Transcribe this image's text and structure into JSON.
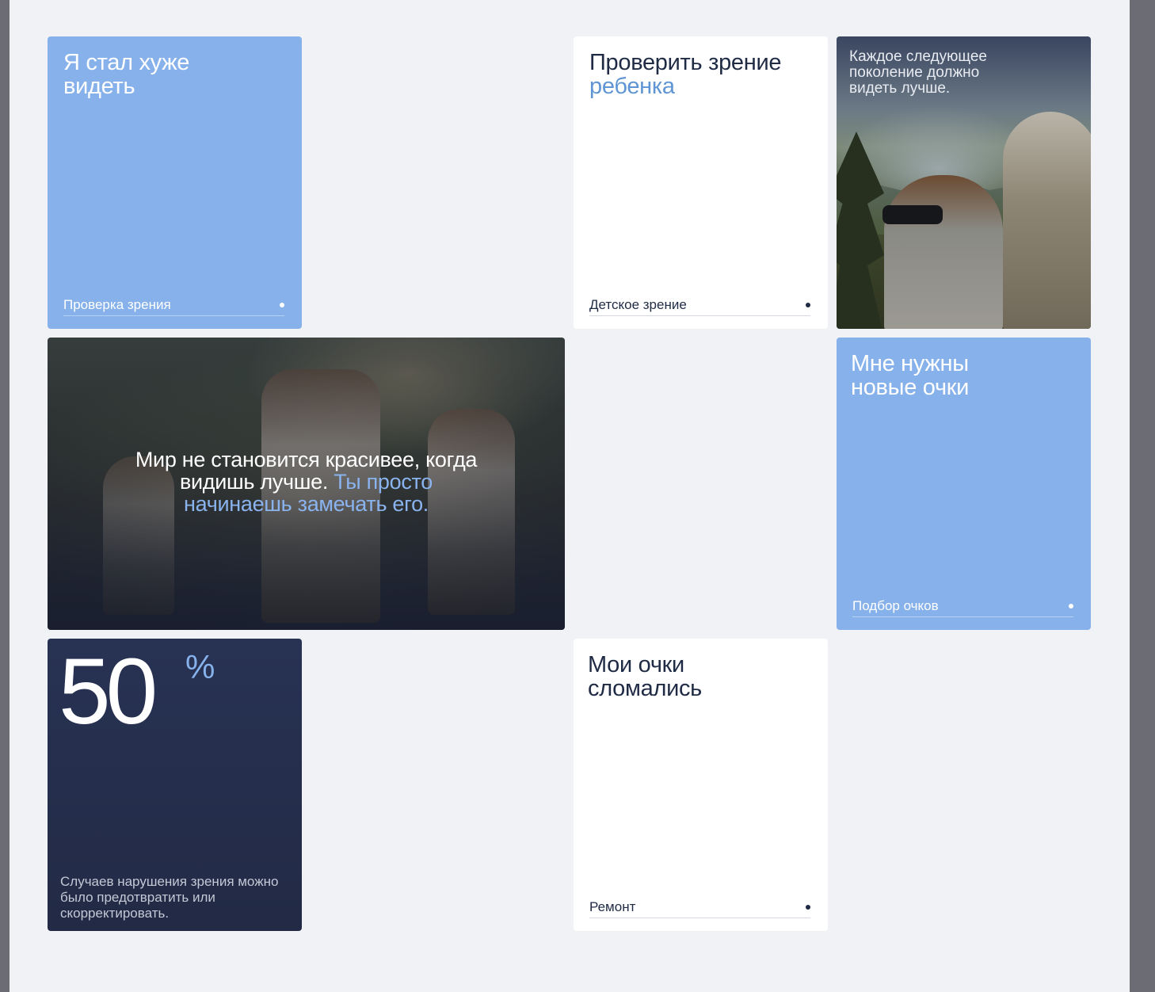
{
  "cards": {
    "vision_worse": {
      "title": "Я стал хуже видеть",
      "link": "Проверка зрения"
    },
    "child_vision": {
      "title_start": "Проверить зрение ",
      "title_accent": "ребенка",
      "link": "Детское зрение"
    },
    "generation": {
      "text": "Каждое следующее поколение должно видеть лучше."
    },
    "quote": {
      "text_start": "Мир не становится красивее, когда видишь лучше. ",
      "text_accent": "Ты просто начинаешь замечать его."
    },
    "new_glasses": {
      "title": "Мне нужны новые очки",
      "link": "Подбор очков"
    },
    "stat": {
      "value": "50",
      "unit": "%",
      "description": "Случаев нарушения зрения можно было предотвратить или скорректировать."
    },
    "broken_glasses": {
      "title": "Мои очки сломались",
      "link": "Ремонт"
    }
  },
  "colors": {
    "accent_blue": "#86b1ea",
    "navy": "#262f4d",
    "background": "#f0f2f6"
  }
}
